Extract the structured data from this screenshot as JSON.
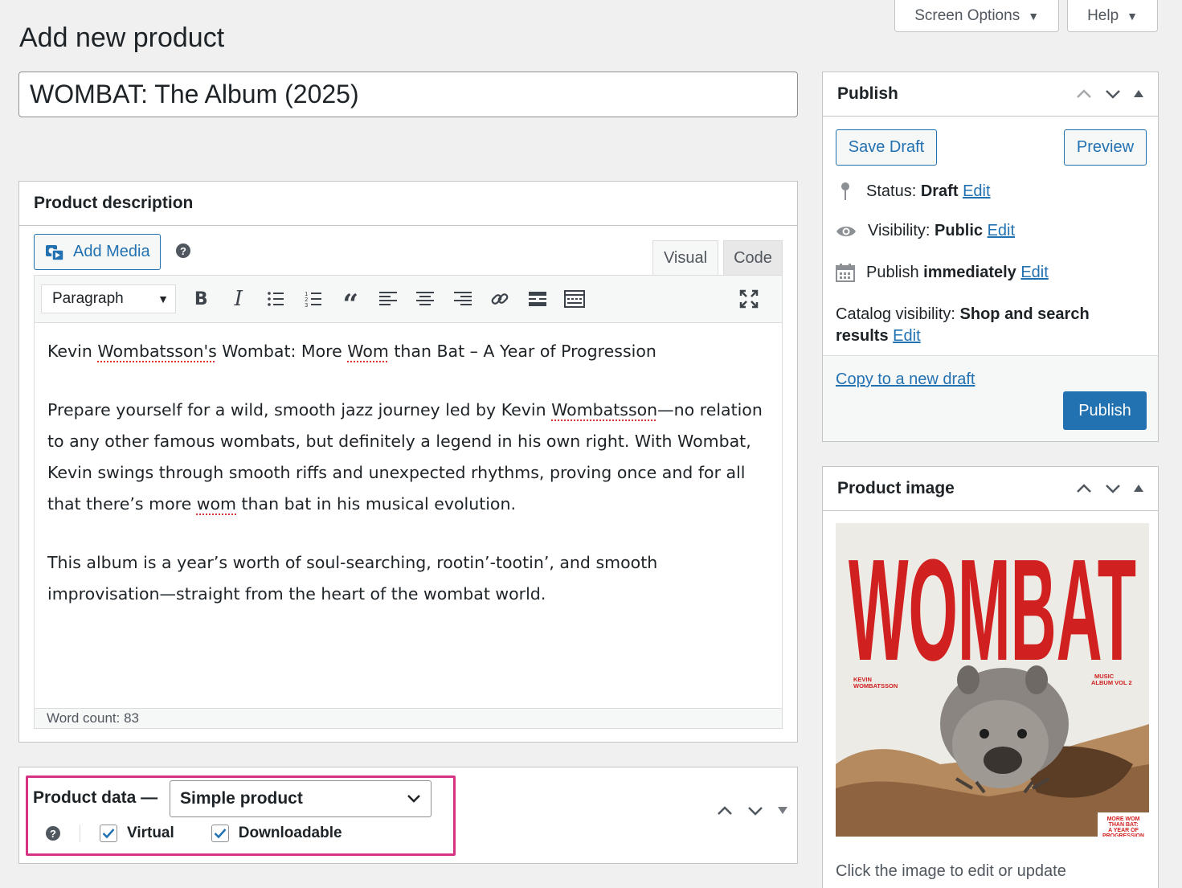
{
  "header": {
    "page_title": "Add new product",
    "screen_options": "Screen Options",
    "help": "Help"
  },
  "title_input": {
    "value": "WOMBAT: The Album (2025)"
  },
  "description": {
    "heading": "Product description",
    "add_media": "Add Media",
    "tabs": {
      "visual": "Visual",
      "code": "Code"
    },
    "format_select": "Paragraph",
    "p1": {
      "a": "Kevin ",
      "b": "Wombatsson's",
      "c": " Wombat: More ",
      "d": "Wom",
      "e": " than Bat – A Year of Progression"
    },
    "p2": {
      "a": "Prepare yourself for a wild, smooth jazz journey led by Kevin ",
      "b": "Wombatsson",
      "c": "—no relation to any other famous wombats, but definitely a legend in his own right. With Wombat, Kevin swings through smooth riffs and unexpected rhythms, proving once and for all that there’s more ",
      "d": "wom",
      "e": " than bat in his musical evolution."
    },
    "p3": "This album is a year’s worth of soul-searching, rootin’-tootin’, and smooth improvisation—straight from the heart of the wombat world.",
    "word_count": "Word count: 83"
  },
  "product_data": {
    "label": "Product data —",
    "type_select": "Simple product",
    "virtual": "Virtual",
    "downloadable": "Downloadable"
  },
  "publish": {
    "heading": "Publish",
    "save_draft": "Save Draft",
    "preview": "Preview",
    "status_label": "Status:",
    "status_value": "Draft",
    "visibility_label": "Visibility:",
    "visibility_value": "Public",
    "publish_label": "Publish",
    "publish_value": "immediately",
    "edit": "Edit",
    "catalog_label": "Catalog visibility:",
    "catalog_value": "Shop and search results",
    "copy_draft": "Copy to a new draft",
    "publish_button": "Publish"
  },
  "product_image": {
    "heading": "Product image",
    "cover_title": "WOMBAT",
    "cover_artist": "KEVIN\nWOMBATSSON",
    "cover_album": "MUSIC\nALBUM VOL 2",
    "cover_sub": "MORE WOM\nTHAN BAT:\nA YEAR OF\nPROGRESSION",
    "hint": "Click the image to edit or update"
  },
  "colors": {
    "accent": "#2271b1",
    "highlight": "#d63384",
    "cover_red": "#d0201f"
  }
}
